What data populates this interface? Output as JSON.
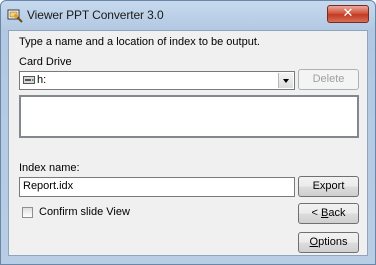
{
  "window": {
    "title": "Viewer PPT Converter 3.0",
    "close_glyph": "✕"
  },
  "instruction": "Type a name and a location of index to be output.",
  "card_drive": {
    "label": "Card Drive",
    "selected_value": "h:",
    "icon": "drive-icon"
  },
  "buttons": {
    "delete": "Delete",
    "export": "Export",
    "back_prefix": "< ",
    "back_mnemonic": "B",
    "back_rest": "ack",
    "options_prefix": "",
    "options_mnemonic": "O",
    "options_rest": "ptions"
  },
  "index_name": {
    "label": "Index name:",
    "value": "Report.idx"
  },
  "confirm": {
    "label": "Confirm slide View",
    "checked": false
  },
  "colors": {
    "close_button": "#c23b21",
    "title_bar": "#b9cde4"
  }
}
